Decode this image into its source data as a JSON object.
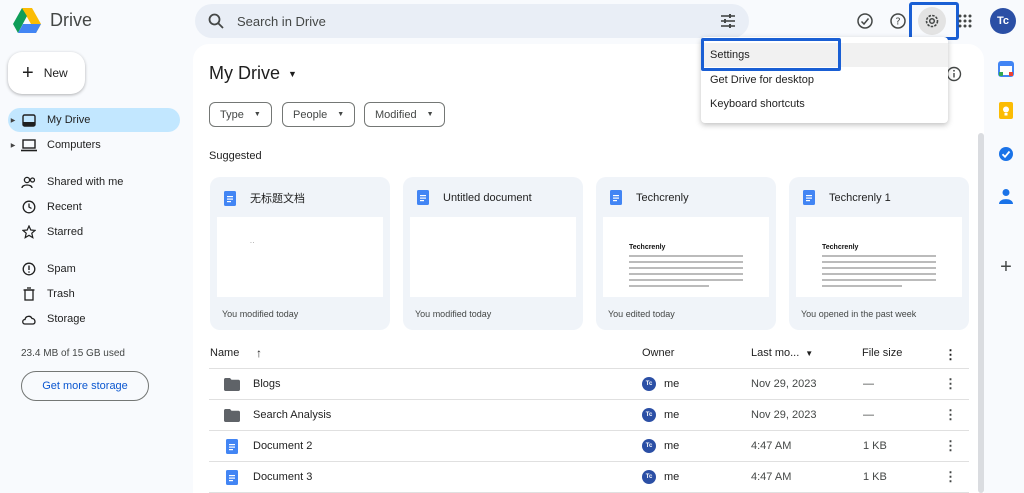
{
  "app": {
    "name": "Drive"
  },
  "search": {
    "placeholder": "Search in Drive"
  },
  "account": {
    "initials": "Tc"
  },
  "new_button": {
    "label": "New"
  },
  "sidebar": {
    "items": [
      {
        "label": "My Drive",
        "icon": "my-drive-icon"
      },
      {
        "label": "Computers",
        "icon": "computers-icon"
      },
      {
        "label": "Shared with me",
        "icon": "shared-icon"
      },
      {
        "label": "Recent",
        "icon": "clock-icon"
      },
      {
        "label": "Starred",
        "icon": "star-icon"
      },
      {
        "label": "Spam",
        "icon": "spam-icon"
      },
      {
        "label": "Trash",
        "icon": "trash-icon"
      },
      {
        "label": "Storage",
        "icon": "cloud-icon"
      }
    ],
    "storage_used": "23.4 MB of 15 GB used",
    "storage_button": "Get more storage"
  },
  "main": {
    "title": "My Drive",
    "filters": [
      "Type",
      "People",
      "Modified"
    ],
    "suggested_label": "Suggested",
    "cards": [
      {
        "title": "无标题文档",
        "footer": "You modified today"
      },
      {
        "title": "Untitled document",
        "footer": "You modified today"
      },
      {
        "title": "Techcrenly",
        "footer": "You edited today",
        "preview_title": "Techcrenly"
      },
      {
        "title": "Techcrenly 1",
        "footer": "You opened in the past week",
        "preview_title": "Techcrenly"
      }
    ],
    "table": {
      "headers": {
        "name": "Name",
        "owner": "Owner",
        "modified": "Last mo...",
        "size": "File size"
      },
      "rows": [
        {
          "name": "Blogs",
          "type": "folder",
          "owner": "me",
          "modified": "Nov 29, 2023",
          "size": "—"
        },
        {
          "name": "Search Analysis",
          "type": "folder",
          "owner": "me",
          "modified": "Nov 29, 2023",
          "size": "—"
        },
        {
          "name": "Document 2",
          "type": "doc",
          "owner": "me",
          "modified": "4:47 AM",
          "size": "1 KB"
        },
        {
          "name": "Document 3",
          "type": "doc",
          "owner": "me",
          "modified": "4:47 AM",
          "size": "1 KB"
        }
      ]
    }
  },
  "settings_menu": {
    "items": [
      "Settings",
      "Get Drive for desktop",
      "Keyboard shortcuts"
    ]
  },
  "colors": {
    "accent": "#0b57d0",
    "highlight": "#1a5fd4",
    "active_nav": "#c2e7ff",
    "doc_blue": "#4285f4"
  }
}
